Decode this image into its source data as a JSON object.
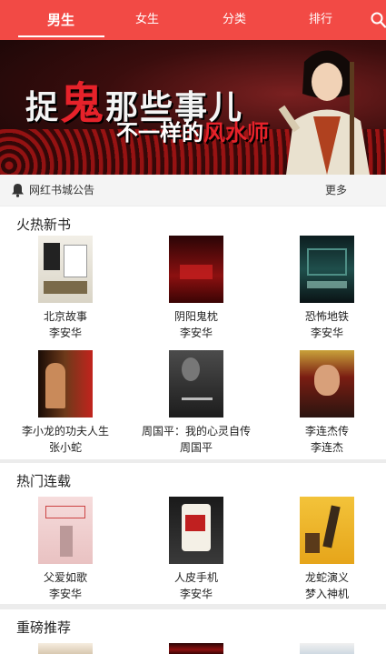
{
  "header": {
    "tabs": [
      {
        "label": "男生",
        "active": true
      },
      {
        "label": "女生",
        "active": false
      },
      {
        "label": "分类",
        "active": false
      },
      {
        "label": "排行",
        "active": false
      }
    ],
    "search_icon": "search-icon",
    "bg_color": "#f24a45"
  },
  "banner": {
    "line1_pre": "捉",
    "line1_red": "鬼",
    "line1_post": "那些事儿",
    "line2_pre": "不一样的",
    "line2_red": "风水师"
  },
  "notice": {
    "icon": "bell-icon",
    "text": "网红书城公告",
    "more": "更多"
  },
  "sections": [
    {
      "title": "火热新书",
      "books": [
        {
          "name": "北京故事",
          "author": "李安华"
        },
        {
          "name": "阴阳鬼枕",
          "author": "李安华"
        },
        {
          "name": "恐怖地铁",
          "author": "李安华"
        },
        {
          "name": "李小龙的功夫人生",
          "author": "张小蛇"
        },
        {
          "name": "周国平：我的心灵自传",
          "author": "周国平"
        },
        {
          "name": "李连杰传",
          "author": "李连杰"
        }
      ]
    },
    {
      "title": "热门连载",
      "books": [
        {
          "name": "父爱如歌",
          "author": "李安华"
        },
        {
          "name": "人皮手机",
          "author": "李安华"
        },
        {
          "name": "龙蛇演义",
          "author": "梦入神机"
        }
      ]
    },
    {
      "title": "重磅推荐",
      "books": []
    }
  ]
}
